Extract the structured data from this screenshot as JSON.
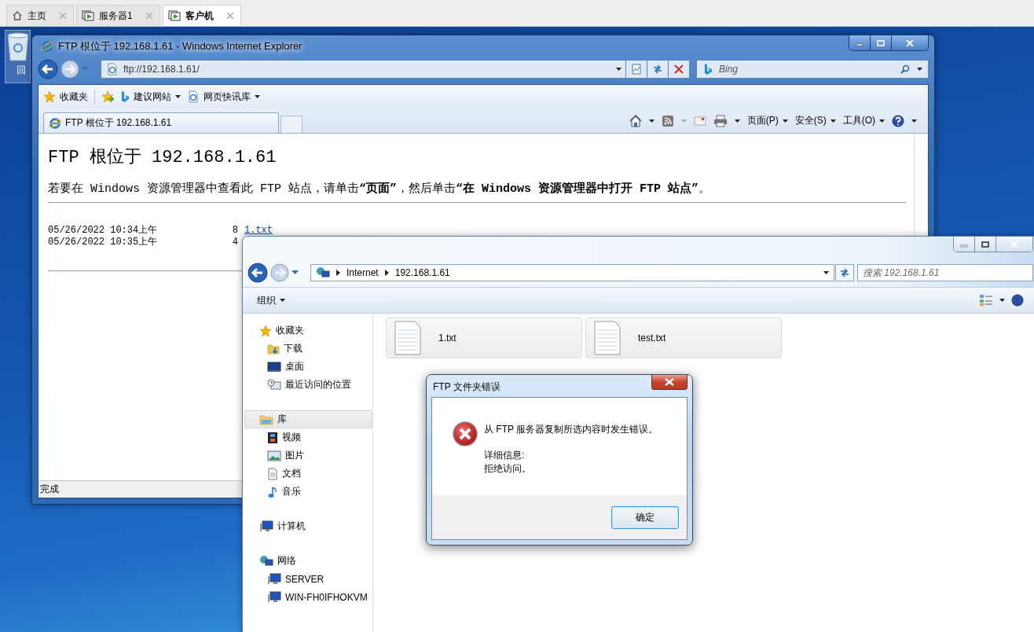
{
  "vm_tabs": [
    {
      "label": "主页",
      "kind": "home",
      "selected": false
    },
    {
      "label": "服务器1",
      "kind": "vm",
      "selected": false
    },
    {
      "label": "客户机",
      "kind": "vm",
      "selected": true
    }
  ],
  "desktop_icons": [
    {
      "label": "回",
      "kind": "recycle"
    }
  ],
  "ie_window": {
    "title": "FTP 根位于 192.168.1.61 - Windows Internet Explorer",
    "address": "ftp://192.168.1.61/",
    "search_placeholder": "Bing",
    "favorites_bar": [
      {
        "label": "收藏夹",
        "kind": "favorites"
      },
      {
        "label": "建议网站",
        "kind": "bing"
      },
      {
        "label": "网页快讯库",
        "kind": "page"
      }
    ],
    "tabs": [
      {
        "label": "FTP 根位于 192.168.1.61",
        "selected": true
      }
    ],
    "command_menus": [
      "页面(P)",
      "安全(S)",
      "工具(O)"
    ],
    "page": {
      "heading": "FTP 根位于 192.168.1.61",
      "instruction": "若要在 Windows 资源管理器中查看此 FTP 站点，请单击**“页面”**，然后单击**“在 Windows 资源管理器中打开 FTP 站点”**。",
      "listing": [
        {
          "date": "05/26/2022 10:34上午",
          "size": "8",
          "name": "1.txt"
        },
        {
          "date": "05/26/2022 10:35上午",
          "size": "4"
        }
      ]
    },
    "status_bar": "完成"
  },
  "explorer_window": {
    "breadcrumb": [
      "Internet",
      "192.168.1.61"
    ],
    "search_placeholder": "搜索 192.168.1.61",
    "toolbar": [
      "组织"
    ],
    "nav": [
      {
        "label": "收藏夹",
        "kind": "favorites",
        "selected": false,
        "children": [
          {
            "label": "下载",
            "kind": "downloads",
            "selected": false
          },
          {
            "label": "桌面",
            "kind": "desktop",
            "selected": false
          },
          {
            "label": "最近访问的位置",
            "kind": "recent",
            "selected": false
          }
        ]
      },
      {
        "label": "库",
        "kind": "library",
        "selected": true,
        "children": [
          {
            "label": "视频",
            "kind": "video",
            "selected": false
          },
          {
            "label": "图片",
            "kind": "pictures",
            "selected": false
          },
          {
            "label": "文档",
            "kind": "documents",
            "selected": false
          },
          {
            "label": "音乐",
            "kind": "music",
            "selected": false
          }
        ]
      },
      {
        "label": "计算机",
        "kind": "computer",
        "selected": false
      },
      {
        "label": "网络",
        "kind": "network",
        "selected": false,
        "children": [
          {
            "label": "SERVER",
            "kind": "computer",
            "selected": false
          },
          {
            "label": "WIN-FH0IFHOKVM",
            "kind": "computer",
            "selected": false
          }
        ]
      }
    ],
    "files": [
      {
        "name": "1.txt"
      },
      {
        "name": "test.txt"
      }
    ]
  },
  "dialog": {
    "title": "FTP 文件夹错误",
    "kind": "error",
    "message": "从 FTP 服务器复制所选内容时发生错误。",
    "detail_label": "详细信息:",
    "detail": "拒绝访问。",
    "buttons": [
      "确定"
    ]
  }
}
